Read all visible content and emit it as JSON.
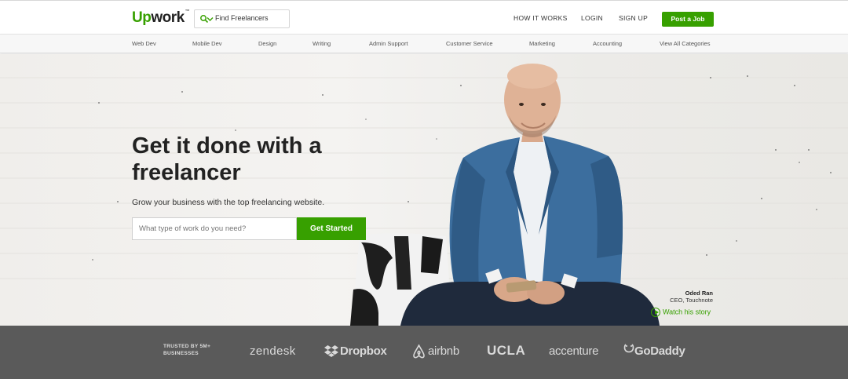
{
  "header": {
    "logo_up": "Up",
    "logo_rest": "work",
    "logo_tm": "™",
    "search_placeholder": "Find Freelancers",
    "nav": [
      "HOW IT WORKS",
      "LOGIN",
      "SIGN UP"
    ],
    "post_job": "Post a Job"
  },
  "categories": [
    "Web Dev",
    "Mobile Dev",
    "Design",
    "Writing",
    "Admin Support",
    "Customer Service",
    "Marketing",
    "Accounting",
    "View All Categories"
  ],
  "hero": {
    "headline": "Get it done with a freelancer",
    "subheadline": "Grow your business with the top freelancing website.",
    "input_placeholder": "What type of work do you need?",
    "cta": "Get Started",
    "person_name": "Oded Ran",
    "person_role": "CEO, Touchnote",
    "watch_story": "Watch his story"
  },
  "trusted": {
    "label": "TRUSTED BY 5M+ BUSINESSES",
    "brands": [
      "zendesk",
      "Dropbox",
      "airbnb",
      "UCLA",
      "accenture",
      "GoDaddy"
    ]
  },
  "colors": {
    "brand_green": "#37a000",
    "trusted_bg": "#5a5a5a"
  }
}
